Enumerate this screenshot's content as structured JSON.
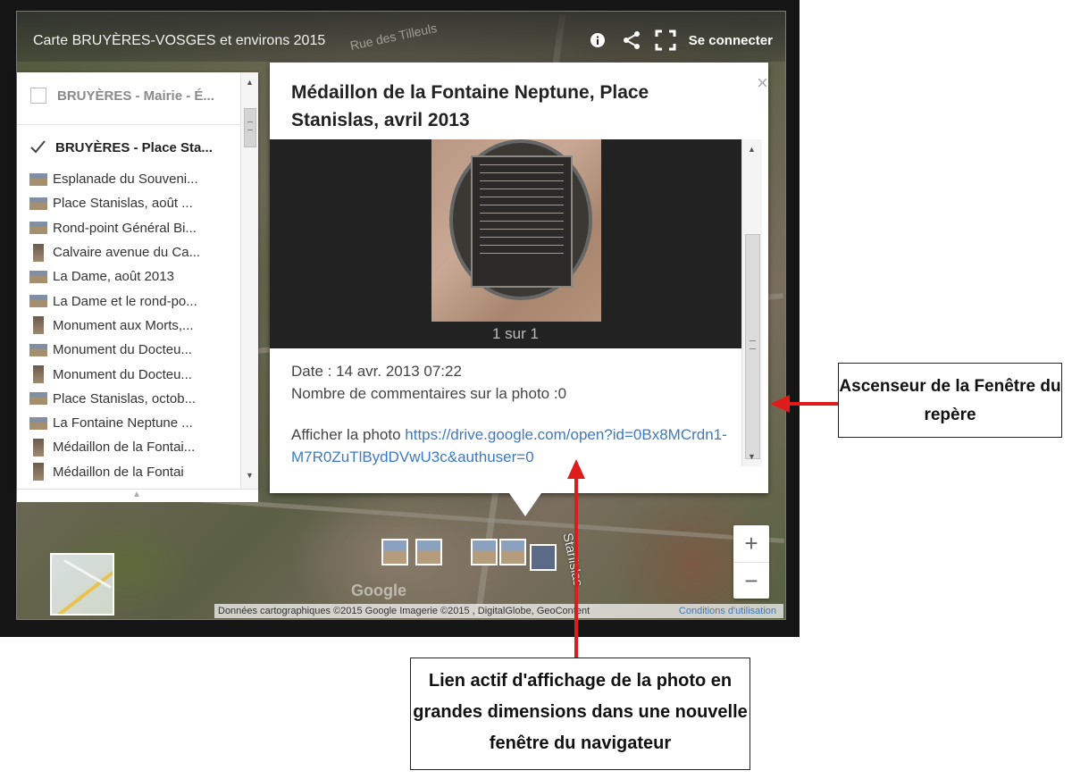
{
  "header": {
    "title": "Carte BRUYÈRES-VOSGES et environs 2015",
    "sign_in": "Se connecter",
    "icons": [
      "info-icon",
      "share-icon",
      "fullscreen-icon"
    ]
  },
  "map": {
    "street_top": "Rue des Tilleuls",
    "street_right": "Stanislas",
    "watermark": "Google",
    "attribution": "Données cartographiques ©2015 Google Imagerie ©2015 , DigitalGlobe, GeoContent",
    "terms": "Conditions d'utilisation",
    "zoom_in": "+",
    "zoom_out": "−"
  },
  "legend": {
    "layers": [
      {
        "label": "BRUYÈRES - Mairie - É...",
        "checked": false
      },
      {
        "label": "BRUYÈRES - Place Sta...",
        "checked": true
      }
    ],
    "items": [
      "Esplanade du Souveni...",
      "Place Stanislas, août ...",
      "Rond-point Général Bi...",
      "Calvaire avenue du Ca...",
      "La Dame, août 2013",
      "La Dame et le rond-po...",
      "Monument aux Morts,...",
      "Monument du Docteu...",
      "Monument du Docteu...",
      "Place Stanislas, octob...",
      "La Fontaine Neptune ...",
      "Médaillon de la Fontai...",
      "Médaillon de la Fontai"
    ]
  },
  "popup": {
    "title": "Médaillon de la Fontaine Neptune, Place Stanislas, avril 2013",
    "counter": "1 sur 1",
    "date": "Date : 14 avr. 2013 07:22",
    "comments": "Nombre de commentaires sur la photo :0",
    "link_prefix": "Afficher la photo ",
    "link_text": "https://drive.google.com/open?id=0Bx8MCrdn1-M7R0ZuTlBydDVwU3c&authuser=0",
    "close": "×"
  },
  "annotations": {
    "scrollbar": "Ascenseur de la Fenêtre du repère",
    "link": "Lien actif d'affichage de la photo en grandes dimensions dans une nouvelle fenêtre du navigateur",
    "arrow_color": "#e01b1b"
  }
}
